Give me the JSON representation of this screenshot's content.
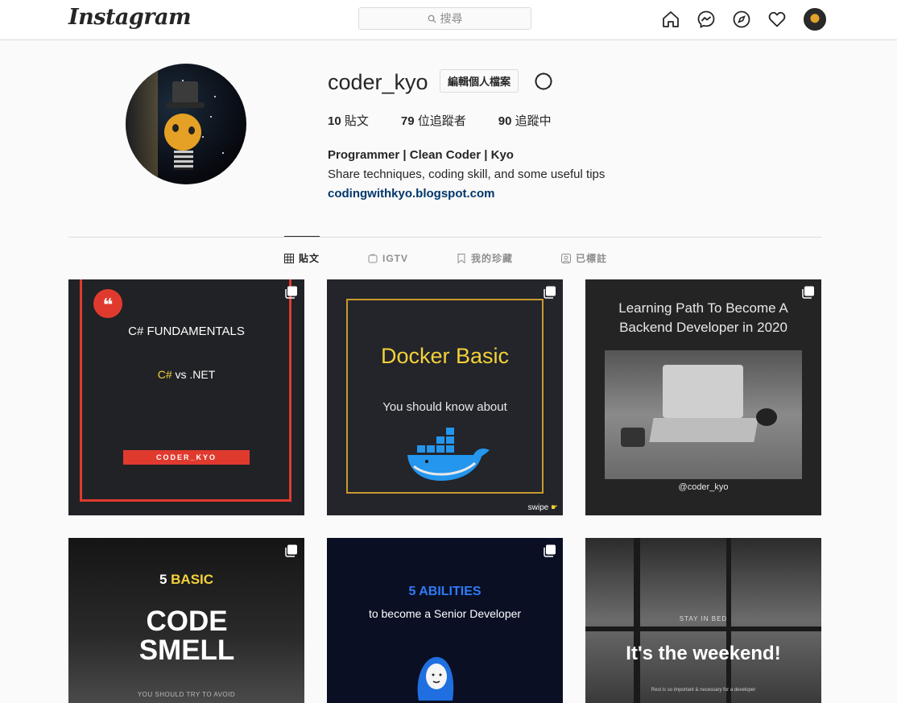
{
  "nav": {
    "logo": "Instagram",
    "search_placeholder": "搜尋",
    "icons": [
      "home-icon",
      "messenger-icon",
      "explore-icon",
      "heart-icon",
      "profile-avatar"
    ]
  },
  "profile": {
    "username": "coder_kyo",
    "edit_label": "編輯個人檔案",
    "stats": {
      "posts_count": "10",
      "posts_label": "貼文",
      "followers_count": "79",
      "followers_label": "位追蹤者",
      "following_count": "90",
      "following_label": "追蹤中"
    },
    "bio_name": "Programmer | Clean Coder | Kyo",
    "bio_text": "Share techniques, coding skill, and some useful tips",
    "bio_link": "codingwithkyo.blogspot.com"
  },
  "tabs": [
    {
      "label": "貼文",
      "icon": "grid-icon",
      "active": true
    },
    {
      "label": "IGTV",
      "icon": "igtv-icon",
      "active": false
    },
    {
      "label": "我的珍藏",
      "icon": "bookmark-icon",
      "active": false
    },
    {
      "label": "已標註",
      "icon": "tagged-icon",
      "active": false
    }
  ],
  "posts": [
    {
      "title": "C# FUNDAMENTALS",
      "subtitle_a": "C#",
      "subtitle_b": " vs .NET",
      "tag": "CODER_KYO"
    },
    {
      "title": "Docker Basic",
      "subtitle": "You should know about",
      "tag": "swipe"
    },
    {
      "title": "Learning Path To Become A Backend Developer in 2020",
      "tag": "@coder_kyo"
    },
    {
      "title_a": "5 ",
      "title_b": "BASIC",
      "big": "CODE SMELL",
      "small": "YOU SHOULD TRY TO AVOID"
    },
    {
      "title": "5 ABILITIES",
      "subtitle": "to become a Senior Developer"
    },
    {
      "small": "STAY IN BED",
      "title": "It's the weekend!",
      "caption": "Rest is so important & necessary for a developer"
    }
  ],
  "colors": {
    "link": "#00376b",
    "accent_red": "#e03a2f",
    "docker_yellow": "#f3d13a",
    "border": "#dbdbdb"
  }
}
